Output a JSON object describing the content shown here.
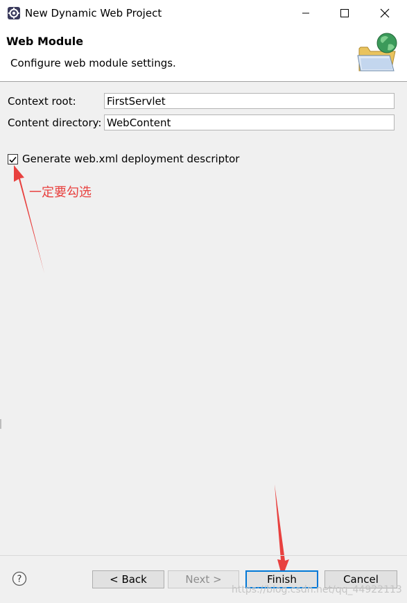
{
  "window": {
    "title": "New Dynamic Web Project",
    "icons": {
      "app": "eclipse-icon",
      "minimize": "minimize-icon",
      "maximize": "maximize-icon",
      "close": "close-icon"
    }
  },
  "header": {
    "title": "Web Module",
    "description": "Configure web module settings.",
    "icon": "folder-globe-icon"
  },
  "form": {
    "context_root_label": "Context root:",
    "context_root_value": "FirstServlet",
    "content_dir_label": "Content directory:",
    "content_dir_value": "WebContent",
    "generate_descriptor_label": "Generate web.xml deployment descriptor",
    "generate_descriptor_checked": true
  },
  "annotation": {
    "note": "一定要勾选",
    "color": "#e8413f"
  },
  "footer": {
    "help_icon": "help-icon",
    "back_label": "< Back",
    "next_label": "Next >",
    "finish_label": "Finish",
    "cancel_label": "Cancel",
    "watermark": "https://blog.csdn.net/qq_44922113"
  }
}
